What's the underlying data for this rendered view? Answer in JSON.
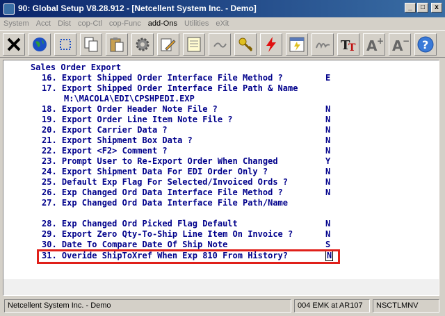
{
  "window": {
    "title": "90: Global Setup V8.28.912 - [Netcellent System Inc. - Demo]",
    "minimize": "_",
    "maximize": "□",
    "close": "x"
  },
  "menu": [
    {
      "label": "System",
      "active": false
    },
    {
      "label": "Acct",
      "active": false
    },
    {
      "label": "Dist",
      "active": false
    },
    {
      "label": "cop-Ctl",
      "active": false
    },
    {
      "label": "cop-Func",
      "active": false
    },
    {
      "label": "add-Ons",
      "active": true
    },
    {
      "label": "Utilities",
      "active": false
    },
    {
      "label": "eXit",
      "active": false
    }
  ],
  "toolbar": {
    "icons": [
      "exit-icon",
      "globe-icon",
      "select-icon",
      "copy-icon",
      "paste-icon",
      "settings-gear-icon",
      "edit-icon",
      "notes-icon",
      "keys-icon",
      "lightning-icon",
      "report-icon",
      "signature-icon",
      "font-icon",
      "font-larger-icon",
      "font-smaller-icon",
      "help-icon"
    ]
  },
  "screen": {
    "heading": "Sales Order Export",
    "path_value": "M:\\MACOLA\\EDI\\CPSHPEDI.EXP",
    "items": [
      {
        "text": "16. Export Shipped Order Interface File Method ?",
        "value": "E"
      },
      {
        "text": "17. Export Shipped Order Interface File Path & Name",
        "value": ""
      },
      {
        "text": "18. Export Order Header Note File ?",
        "value": "N"
      },
      {
        "text": "19. Export Order Line Item Note File ?",
        "value": "N"
      },
      {
        "text": "20. Export Carrier Data ?",
        "value": "N"
      },
      {
        "text": "21. Export Shipment Box Data ?",
        "value": "N"
      },
      {
        "text": "22. Export <F2> Comment ?",
        "value": "N"
      },
      {
        "text": "23. Prompt User to Re-Export Order When Changed",
        "value": "Y"
      },
      {
        "text": "24. Export Shipment Data For EDI Order Only ?",
        "value": "N"
      },
      {
        "text": "25. Default Exp Flag For Selected/Invoiced Ords ?",
        "value": "N"
      },
      {
        "text": "26. Exp Changed Ord Data Interface File Method ?",
        "value": "N"
      },
      {
        "text": "27. Exp Changed Ord Data Interface File Path/Name",
        "value": ""
      },
      {
        "text": "28. Exp Changed Ord Picked Flag Default",
        "value": "N"
      },
      {
        "text": "29. Export Zero Qty-To-Ship Line Item On Invoice ?",
        "value": "N"
      },
      {
        "text": "30. Date To Compare Date Of Ship Note",
        "value": "S"
      },
      {
        "text": "31. Overide ShipToXref When Exp 810 From History?",
        "value": "N"
      }
    ]
  },
  "status": {
    "company": "Netcellent System Inc. - Demo",
    "session": "004 EMK at AR107",
    "machine": "NSCTLMNV"
  },
  "colors": {
    "text": "#00008b",
    "highlight": "#e0201a",
    "title_start": "#0a246a",
    "title_end": "#3a6ea5"
  }
}
